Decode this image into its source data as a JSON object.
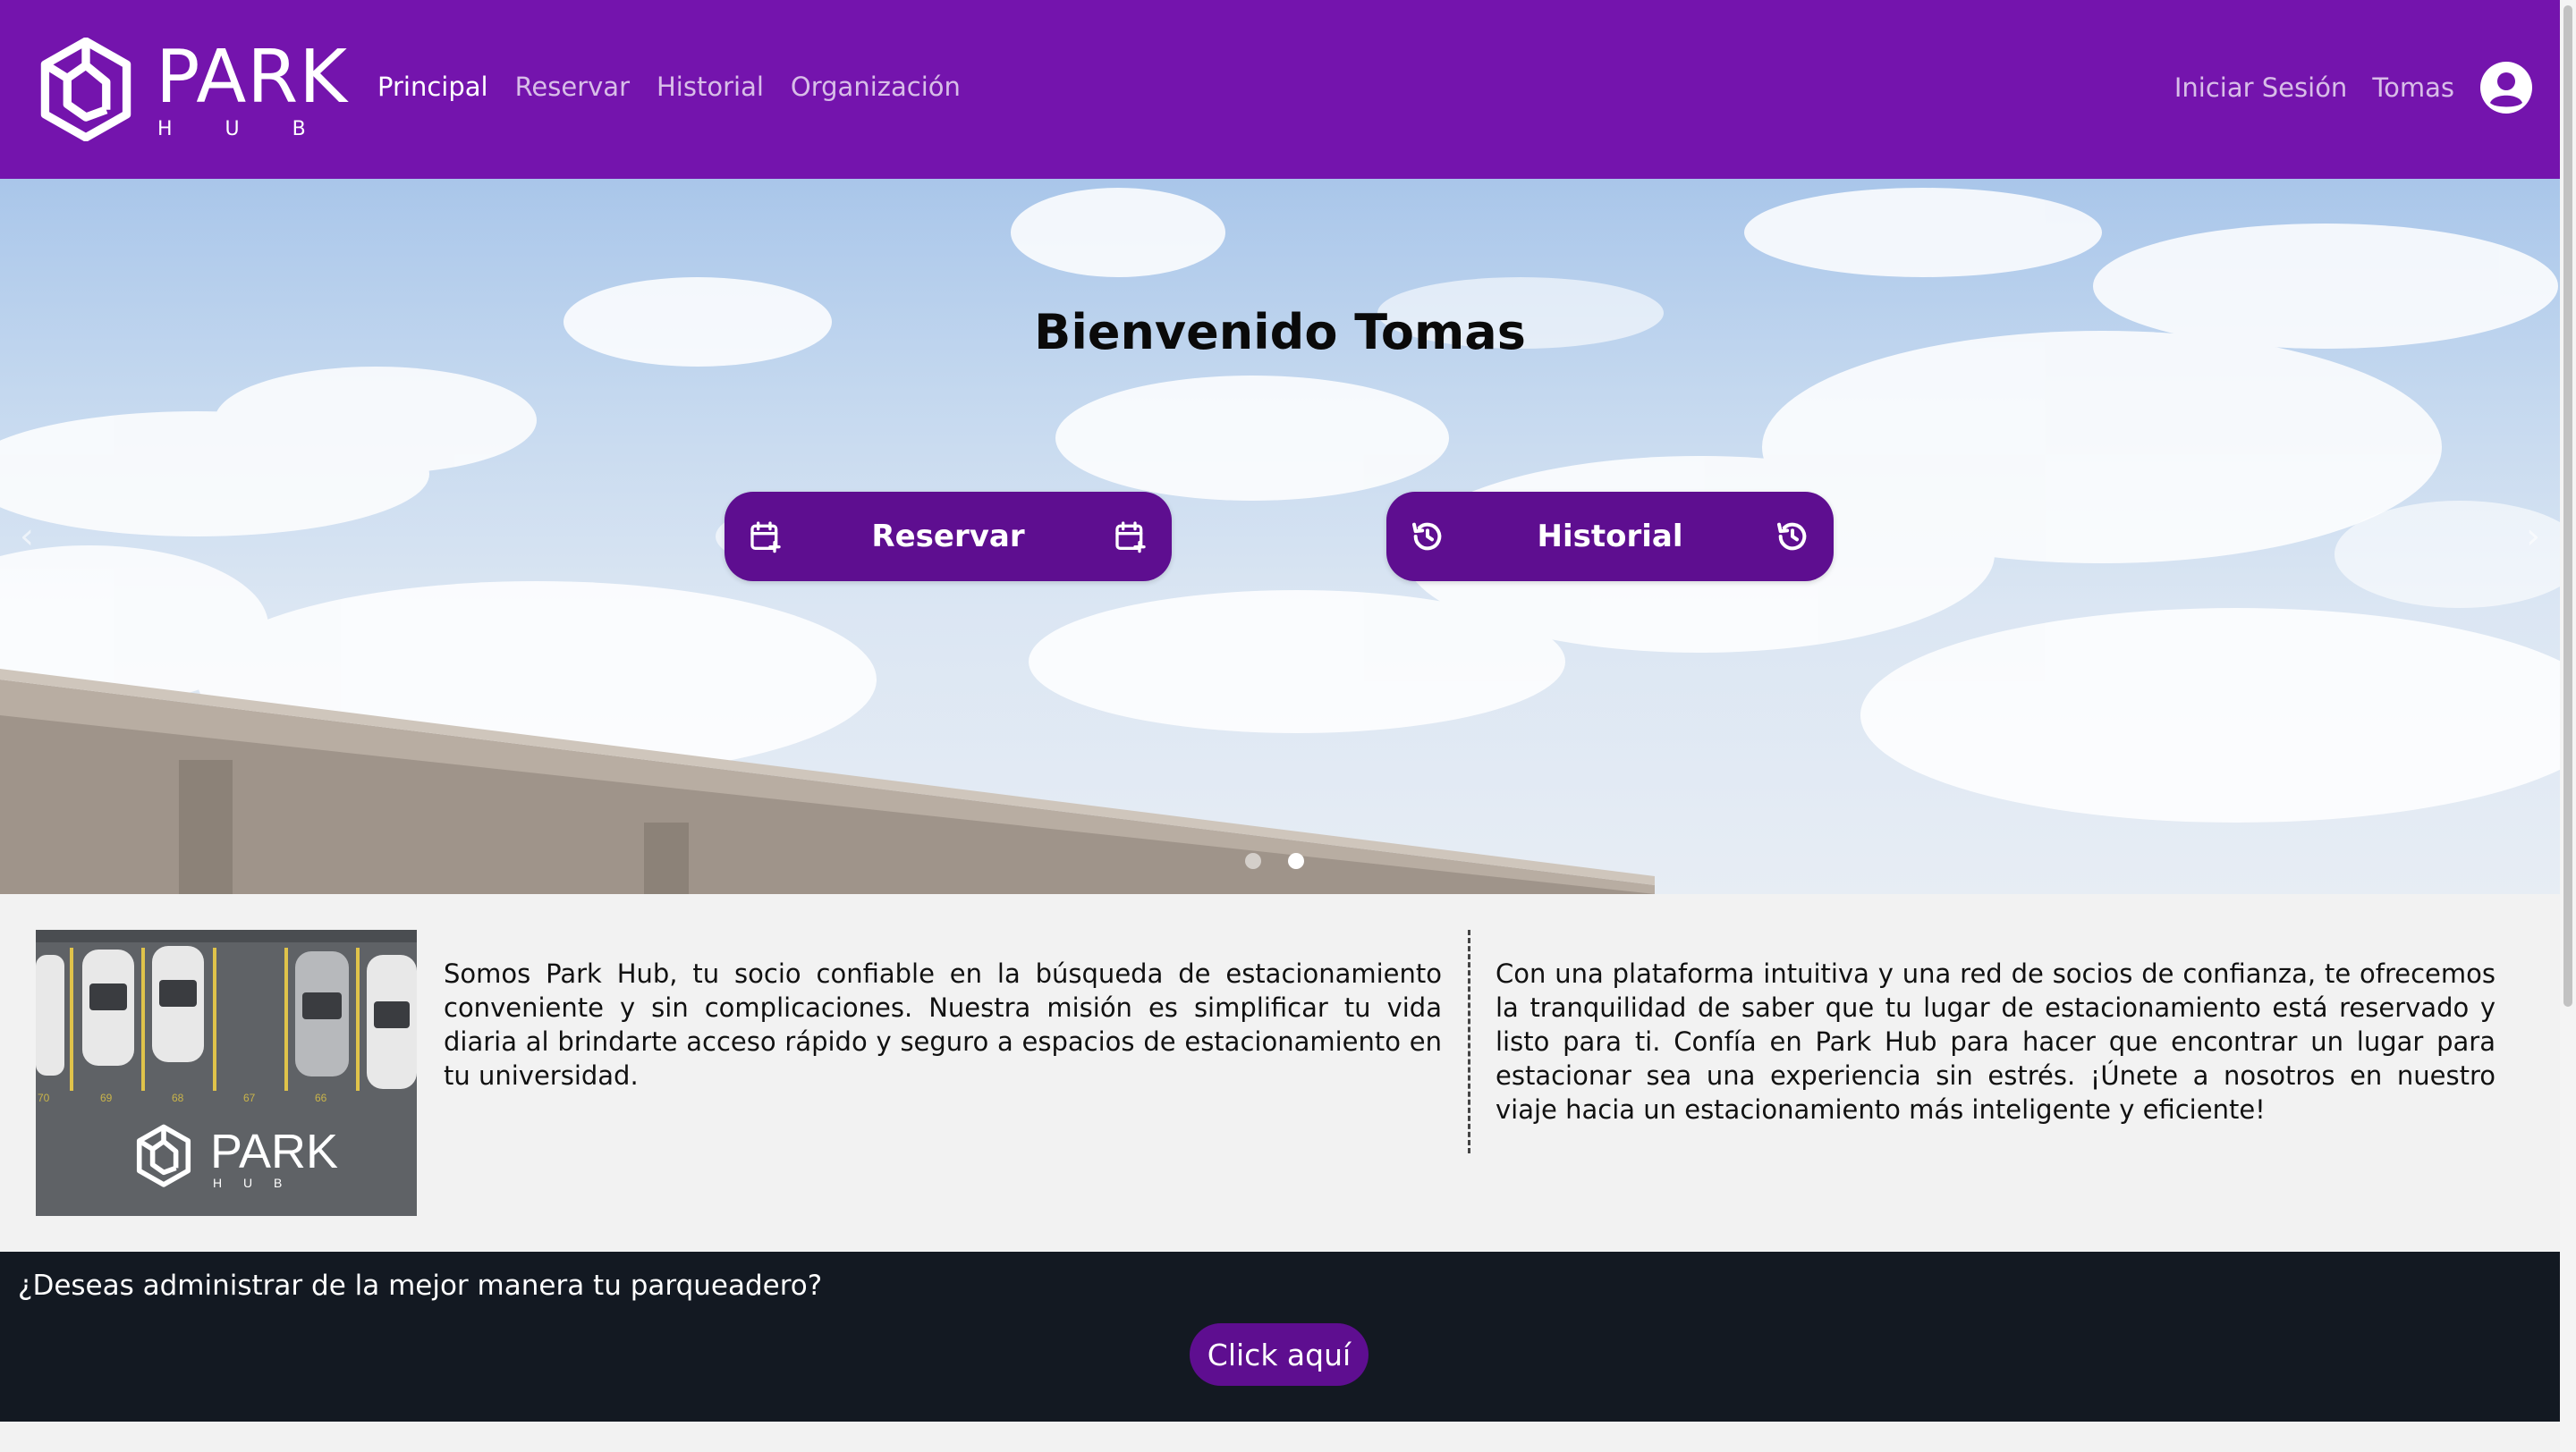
{
  "brand": {
    "name": "PARK",
    "sub": "H U B"
  },
  "nav": {
    "links": [
      "Principal",
      "Reservar",
      "Historial",
      "Organización"
    ],
    "active": "Principal",
    "login": "Iniciar Sesión",
    "user": "Tomas"
  },
  "hero": {
    "title": "Bienvenido Tomas",
    "reservar_label": "Reservar",
    "historial_label": "Historial",
    "slides": 2,
    "active_slide": 2
  },
  "about": {
    "left": "Somos Park Hub, tu socio confiable en la búsqueda de estacionamiento conveniente y sin complicaciones. Nuestra misión es simplificar tu vida diaria al brindarte acceso rápido y seguro a espacios de estacionamiento en tu universidad.",
    "right": "Con una plataforma intuitiva y una red de socios de confianza, te ofrecemos la tranquilidad de saber que tu lugar de estacionamiento está reservado y listo para ti. Confía en Park Hub para hacer que encontrar un lugar para estacionar sea una experiencia sin estrés. ¡Únete a nosotros en nuestro viaje hacia un estacionamiento más inteligente y eficiente!",
    "image_brand": "PARK",
    "image_sub": "H U B",
    "slot_numbers": [
      "70",
      "69",
      "68",
      "67",
      "66"
    ]
  },
  "cta": {
    "question": "¿Deseas administrar de la mejor manera tu parqueadero?",
    "button": "Click aquí"
  },
  "colors": {
    "primary": "#7414ad",
    "button": "#5e0e90",
    "footer": "#131922",
    "page_bg": "#f2f2f2"
  }
}
